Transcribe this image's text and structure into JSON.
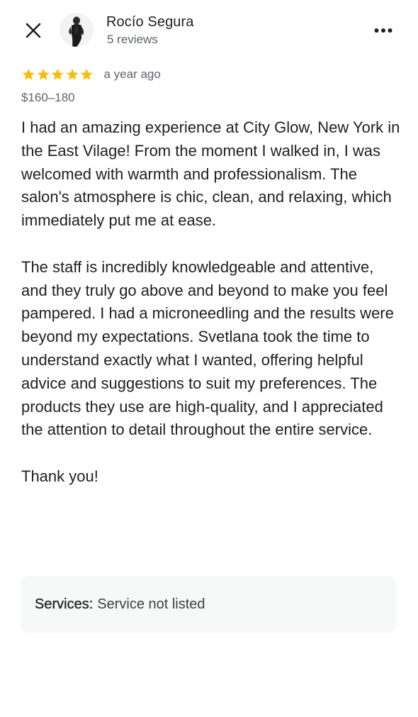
{
  "header": {
    "close_icon": "close-icon",
    "more_icon": "more-horizontal-icon",
    "author_name": "Rocío Segura",
    "author_reviews": "5 reviews",
    "avatar_icon": "avatar-photo"
  },
  "review": {
    "rating": 5,
    "rating_max": 5,
    "star_color": "#fbbc04",
    "date": "a year ago",
    "price": "$160–180",
    "paragraphs": [
      "I had an amazing experience at City Glow, New York in the East Vilage! From the moment I walked in, I was welcomed with warmth and professionalism. The salon's atmosphere is chic, clean, and relaxing, which immediately put me at ease.",
      "The staff is incredibly knowledgeable and attentive, and they truly go above and beyond to make you feel pampered. I had a microneedling and the results were beyond my expectations. Svetlana took the time to understand exactly what I wanted, offering helpful advice and suggestions to suit my preferences. The products they use are high-quality, and I appreciated the attention to detail throughout the entire service.",
      "Thank you!"
    ]
  },
  "services": {
    "label": "Services:",
    "value": "Service not listed"
  }
}
